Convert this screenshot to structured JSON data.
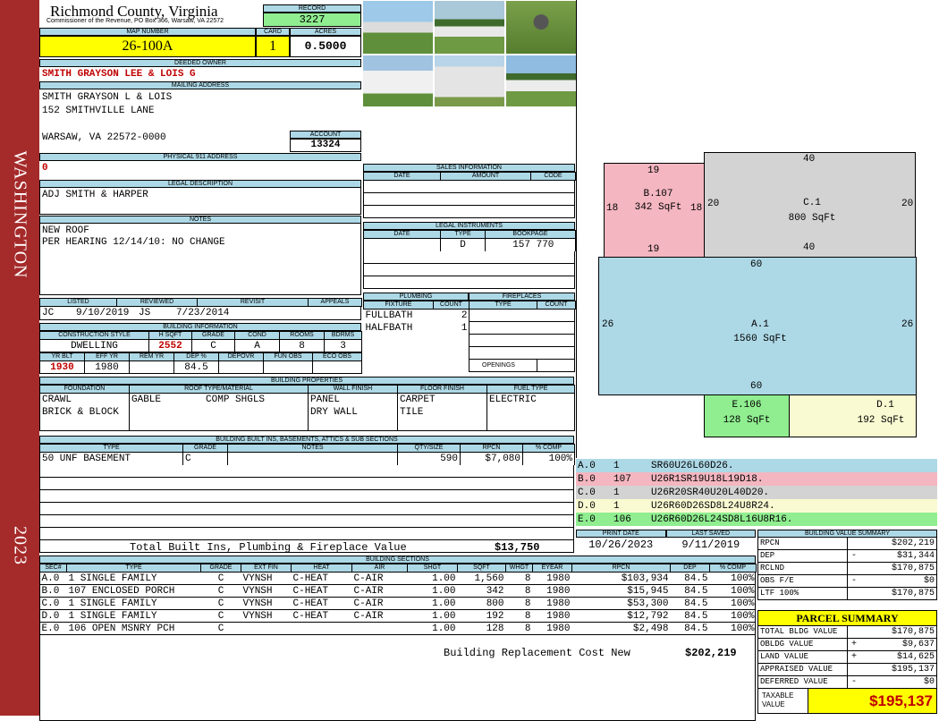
{
  "sidebar": {
    "district": "WASHINGTON",
    "year": "2023"
  },
  "header": {
    "county": "Richmond County, Virginia",
    "office": "Commissioner of the Revenue, PO Box 366, Warsaw, VA 22572",
    "record_label": "RECORD",
    "record": "3227",
    "map_label": "MAP NUMBER",
    "map_number": "26-100A",
    "card_label": "CARD",
    "card": "1",
    "acres_label": "ACRES",
    "acres": "0.5000"
  },
  "owner": {
    "deeded_label": "DEEDED OWNER",
    "deeded": "SMITH GRAYSON LEE & LOIS G",
    "mailing_label": "MAILING ADDRESS",
    "mail1": "SMITH GRAYSON L & LOIS",
    "mail2": "152 SMITHVILLE LANE",
    "mail3": "WARSAW, VA 22572-0000",
    "account_label": "ACCOUNT",
    "account": "13324",
    "phys_label": "PHYSICAL 911 ADDRESS",
    "phys": "0"
  },
  "legal": {
    "label": "LEGAL DESCRIPTION",
    "text": "ADJ SMITH & HARPER"
  },
  "notes": {
    "label": "NOTES",
    "line1": "NEW ROOF",
    "line2": "PER HEARING 12/14/10: NO CHANGE"
  },
  "listing": {
    "listed_label": "LISTED",
    "listed_by": "JC",
    "listed": "9/10/2019",
    "reviewed_label": "REVIEWED",
    "reviewed_by": "JS",
    "reviewed": "7/23/2014",
    "revisit_label": "REVISIT",
    "appeals_label": "APPEALS"
  },
  "building_info": {
    "label": "BUILDING INFORMATION",
    "h": [
      "CONSTRUCTION STYLE",
      "H SQFT",
      "GRADE",
      "COND",
      "ROOMS",
      "BDRMS"
    ],
    "v": [
      "DWELLING",
      "2552",
      "C",
      "A",
      "8",
      "3"
    ],
    "h2": [
      "YR BLT",
      "EFF YR",
      "REM YR",
      "DEP %",
      "DEPOVR",
      "FUN OBS",
      "ECO OBS"
    ],
    "v2": [
      "1930",
      "1980",
      "",
      "84.5",
      "",
      "",
      ""
    ]
  },
  "sales": {
    "label": "SALES INFORMATION",
    "h": [
      "DATE",
      "AMOUNT",
      "CODE"
    ]
  },
  "instruments": {
    "label": "LEGAL INSTRUMENTS",
    "h": [
      "DATE",
      "TYPE",
      "BOOKPAGE"
    ],
    "type": "D",
    "book": "157",
    "page": "770"
  },
  "plumbing": {
    "label": "PLUMBING",
    "h": [
      "FIXTURE",
      "COUNT"
    ],
    "rows": [
      [
        "FULLBATH",
        "2"
      ],
      [
        "HALFBATH",
        "1"
      ]
    ]
  },
  "fireplaces": {
    "label": "FIREPLACES",
    "h": [
      "TYPE",
      "COUNT"
    ],
    "openings": "OPENINGS"
  },
  "properties": {
    "label": "BUILDING PROPERTIES",
    "h": [
      "FOUNDATION",
      "ROOF TYPE/MATERIAL",
      "WALL FINISH",
      "FLOOR FINISH",
      "FUEL TYPE"
    ],
    "found1": "CRAWL",
    "found2": "BRICK & BLOCK",
    "roof1": "GABLE",
    "roof2": "COMP SHGLS",
    "wall1": "PANEL",
    "wall2": "DRY WALL",
    "floor1": "CARPET",
    "floor2": "TILE",
    "fuel": "ELECTRIC"
  },
  "builtins": {
    "label": "BUILDING BUILT INS, BASEMENTS, ATTICS & SUB SECTIONS",
    "h": [
      "TYPE",
      "GRADE",
      "NOTES",
      "QTY/SIZE",
      "RPCN",
      "% COMP"
    ],
    "row": [
      "50 UNF BASEMENT",
      "C",
      "",
      "590",
      "$7,080",
      "100%"
    ],
    "total_label": "Total Built Ins, Plumbing & Fireplace Value",
    "total": "$13,750"
  },
  "sections": {
    "label": "BUILDING SECTIONS",
    "h": [
      "SEC#",
      "TYPE",
      "GRADE",
      "EXT FIN",
      "HEAT",
      "AIR",
      "SHGT",
      "SQFT",
      "WHGT",
      "EYEAR",
      "RPCN",
      "DEP",
      "% COMP"
    ],
    "rows": [
      [
        "A.0",
        "1 SINGLE FAMILY",
        "C",
        "VYNSH",
        "C-HEAT",
        "C-AIR",
        "1.00",
        "1,560",
        "8",
        "1980",
        "$103,934",
        "84.5",
        "100%"
      ],
      [
        "B.0",
        "107 ENCLOSED PORCH",
        "C",
        "VYNSH",
        "C-HEAT",
        "C-AIR",
        "1.00",
        "342",
        "8",
        "1980",
        "$15,945",
        "84.5",
        "100%"
      ],
      [
        "C.0",
        "1 SINGLE FAMILY",
        "C",
        "VYNSH",
        "C-HEAT",
        "C-AIR",
        "1.00",
        "800",
        "8",
        "1980",
        "$53,300",
        "84.5",
        "100%"
      ],
      [
        "D.0",
        "1 SINGLE FAMILY",
        "C",
        "VYNSH",
        "C-HEAT",
        "C-AIR",
        "1.00",
        "192",
        "8",
        "1980",
        "$12,792",
        "84.5",
        "100%"
      ],
      [
        "E.0",
        "106 OPEN MSNRY PCH",
        "C",
        "",
        "",
        "",
        "1.00",
        "128",
        "8",
        "1980",
        "$2,498",
        "84.5",
        "100%"
      ]
    ],
    "total_label": "Building Replacement Cost New",
    "total": "$202,219"
  },
  "print": {
    "print_label": "PRINT DATE",
    "print_date": "10/26/2023",
    "saved_label": "LAST SAVED",
    "saved": "9/11/2019"
  },
  "sketch": {
    "areas": [
      {
        "id": "B.107",
        "sqft": "342 SqFt",
        "top": "19",
        "bottom": "19",
        "left": "18",
        "right": "18",
        "color": "#f4b6c0"
      },
      {
        "id": "C.1",
        "sqft": "800 SqFt",
        "top": "40",
        "bottom": "40",
        "left": "20",
        "right": "20",
        "color": "#d3d3d3"
      },
      {
        "id": "A.1",
        "sqft": "1560 SqFt",
        "top": "60",
        "bottom": "60",
        "left": "26",
        "right": "26",
        "color": "#add8e6"
      },
      {
        "id": "E.106",
        "sqft": "128 SqFt",
        "color": "#90ee90"
      },
      {
        "id": "D.1",
        "sqft": "192 SqFt",
        "color": "#fafad2"
      }
    ],
    "legend": [
      {
        "sec": "A.0",
        "code": "1",
        "path": "SR60U26L60D26.",
        "color": "#add8e6"
      },
      {
        "sec": "B.0",
        "code": "107",
        "path": "U26R1SR19U18L19D18.",
        "color": "#f4b6c0"
      },
      {
        "sec": "C.0",
        "code": "1",
        "path": "U26R20SR40U20L40D20.",
        "color": "#d3d3d3"
      },
      {
        "sec": "D.0",
        "code": "1",
        "path": "U26R60D26SD8L24U8R24.",
        "color": "#fafad2"
      },
      {
        "sec": "E.0",
        "code": "106",
        "path": "U26R60D26L24SD8L16U8R16.",
        "color": "#90ee90"
      }
    ]
  },
  "value_summary": {
    "label": "BUILDING VALUE SUMMARY",
    "rows": [
      [
        "RPCN",
        "",
        "$202,219"
      ],
      [
        "DEP",
        "-",
        "$31,344"
      ],
      [
        "RCLND",
        "",
        "$170,875"
      ],
      [
        "OBS F/E",
        "-",
        "$0"
      ],
      [
        "LTF 100%",
        "",
        "$170,875"
      ]
    ]
  },
  "parcel": {
    "label": "PARCEL SUMMARY",
    "rows": [
      [
        "TOTAL BLDG VALUE",
        "",
        "$170,875"
      ],
      [
        "OBLDG VALUE",
        "+",
        "$9,637"
      ],
      [
        "LAND VALUE",
        "+",
        "$14,625"
      ],
      [
        "APPRAISED VALUE",
        "",
        "$195,137"
      ],
      [
        "DEFERRED VALUE",
        "-",
        "$0"
      ]
    ],
    "taxable_label1": "TAXABLE",
    "taxable_label2": "VALUE",
    "taxable": "$195,137"
  },
  "colors": {
    "sidebar": "#a52a2a",
    "header": "#add8e6",
    "highlight": "#ffff00",
    "red": "#c00000"
  }
}
